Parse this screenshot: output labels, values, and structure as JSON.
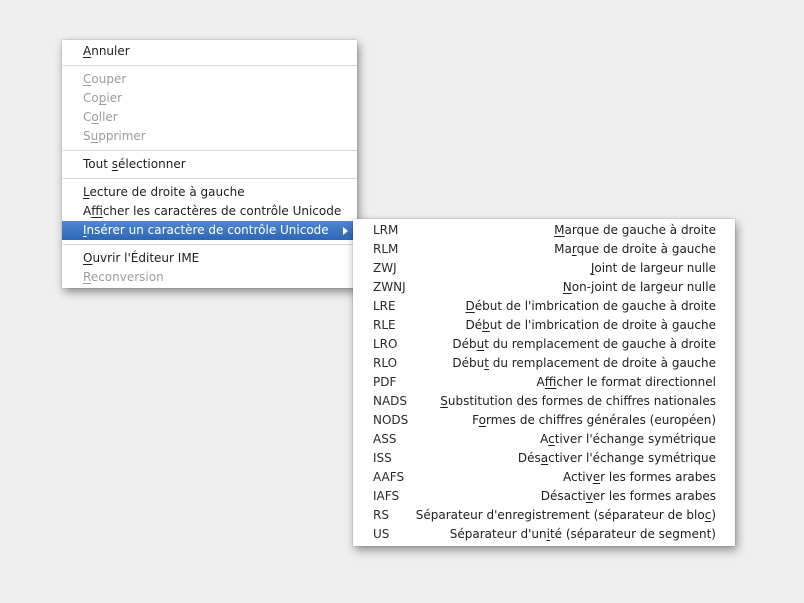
{
  "main_menu": {
    "items": [
      {
        "type": "item",
        "label": "Annuler",
        "accel": 0,
        "disabled": false
      },
      {
        "type": "separator"
      },
      {
        "type": "item",
        "label": "Couper",
        "accel": 0,
        "disabled": true
      },
      {
        "type": "item",
        "label": "Copier",
        "accel": 2,
        "disabled": true
      },
      {
        "type": "item",
        "label": "Coller",
        "accel": 1,
        "disabled": true
      },
      {
        "type": "item",
        "label": "Supprimer",
        "accel": 1,
        "disabled": true
      },
      {
        "type": "separator"
      },
      {
        "type": "item",
        "label": "Tout sélectionner",
        "accel": 5,
        "disabled": false
      },
      {
        "type": "separator"
      },
      {
        "type": "item",
        "label": "Lecture de droite à gauche",
        "accel": 0,
        "disabled": false
      },
      {
        "type": "item",
        "label": "Afficher les caractères de contrôle Unicode",
        "accel": 1,
        "disabled": false
      },
      {
        "type": "item",
        "label": "Insérer un caractère de contrôle Unicode",
        "accel": 0,
        "disabled": false,
        "highlighted": true,
        "submenu": true
      },
      {
        "type": "separator"
      },
      {
        "type": "item",
        "label": "Ouvrir l'Éditeur IME",
        "accel": 0,
        "disabled": false
      },
      {
        "type": "item",
        "label": "Reconversion",
        "accel": 0,
        "disabled": true
      }
    ]
  },
  "submenu": {
    "items": [
      {
        "code": "LRM",
        "label": "Marque de gauche à droite",
        "accel": 0
      },
      {
        "code": "RLM",
        "label": "Marque de droite à gauche",
        "accel": 2
      },
      {
        "code": "ZWJ",
        "label": "Joint de largeur nulle",
        "accel": 0
      },
      {
        "code": "ZWNJ",
        "label": "Non-joint de largeur nulle",
        "accel": 0
      },
      {
        "code": "LRE",
        "label": "Début de l'imbrication de gauche à droite",
        "accel": 0
      },
      {
        "code": "RLE",
        "label": "Début de l'imbrication de droite à gauche",
        "accel": 2
      },
      {
        "code": "LRO",
        "label": "Début du remplacement de gauche à droite",
        "accel": 3
      },
      {
        "code": "RLO",
        "label": "Début du remplacement de droite à gauche",
        "accel": 4
      },
      {
        "code": "PDF",
        "label": "Afficher le format directionnel",
        "accel": 1
      },
      {
        "code": "NADS",
        "label": "Substitution des formes de chiffres nationales",
        "accel": 0
      },
      {
        "code": "NODS",
        "label": "Formes de chiffres générales (européen)",
        "accel": 1
      },
      {
        "code": "ASS",
        "label": "Activer l'échange symétrique",
        "accel": 1
      },
      {
        "code": "ISS",
        "label": "Désactiver l'échange symétrique",
        "accel": 3
      },
      {
        "code": "AAFS",
        "label": "Activer les formes arabes",
        "accel": 5
      },
      {
        "code": "IAFS",
        "label": "Désactiver les formes arabes",
        "accel": 7
      },
      {
        "code": "RS",
        "label": "Séparateur d'enregistrement (séparateur de bloc)",
        "accel": 46
      },
      {
        "code": "US",
        "label": "Séparateur d'unité (séparateur de segment)",
        "accel": 15
      }
    ]
  }
}
